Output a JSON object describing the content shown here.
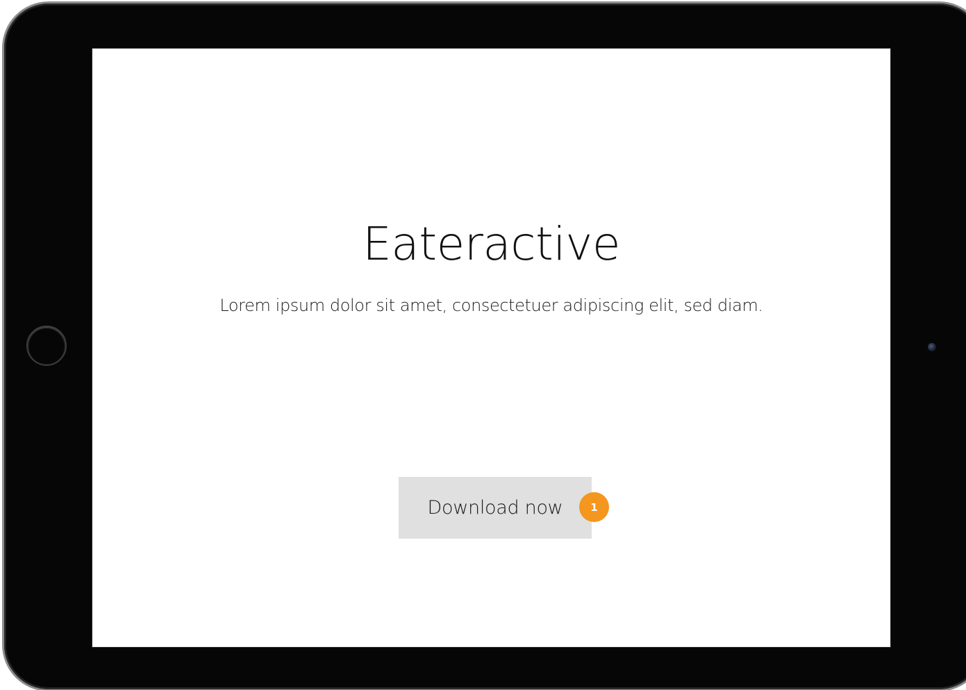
{
  "app": {
    "title": "Eateractive",
    "tagline": "Lorem ipsum dolor sit amet, consectetuer adipiscing elit, sed diam."
  },
  "actions": {
    "download_label": "Download now",
    "download_badge": "1"
  },
  "device": {
    "type": "tablet",
    "orientation": "landscape",
    "home_button_icon": "home-button-ring-icon",
    "camera_icon": "front-camera-icon"
  },
  "colors": {
    "bezel": "#060606",
    "screen_background": "#ffffff",
    "button_background": "#e0e0e0",
    "badge_background": "#f5961e",
    "badge_text": "#ffffff",
    "text": "#111111"
  }
}
